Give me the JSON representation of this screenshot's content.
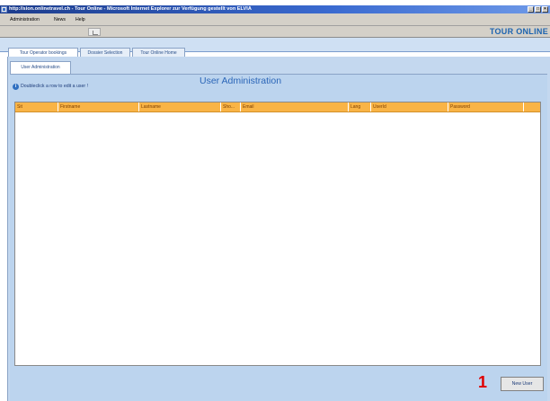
{
  "window": {
    "title": "http://sion.onlinetravel.ch - Tour Online - Microsoft Internet Explorer zur Verfügung gestellt von ELVIA",
    "controls": [
      "_",
      "□",
      "×"
    ]
  },
  "menubar": {
    "items": [
      "Administration",
      "News",
      "Help"
    ]
  },
  "brand": "TOUR ONLINE",
  "main_tabs": [
    {
      "label": "Tour Operator bookings",
      "active": true
    },
    {
      "label": "Dossier Selection",
      "active": false
    },
    {
      "label": "Tour Online Home",
      "active": false
    }
  ],
  "sub_tab": "User Administration",
  "hint": "Doubleclick a row to edit a user !",
  "page_title": "User Administration",
  "grid": {
    "columns": [
      "Sit",
      "Firstname",
      "Lastname",
      "Sho...",
      "Email",
      "Lang",
      "UserId",
      "Password"
    ],
    "rows": []
  },
  "annotation_number": "1",
  "new_user_button": "New User",
  "colors": {
    "header_orange": "#f9b446",
    "panel_blue": "#c4d8ef",
    "title_blue": "#2b66b8"
  }
}
